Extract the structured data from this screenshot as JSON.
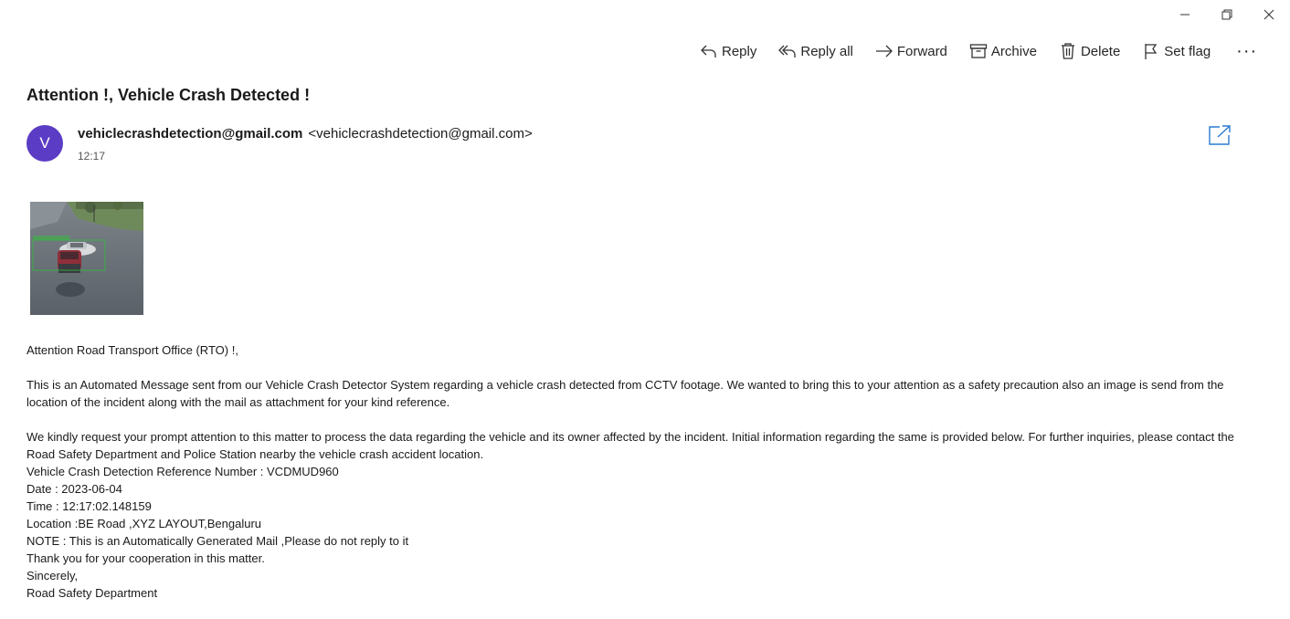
{
  "window": {
    "controls": [
      "minimize-icon",
      "restore-icon",
      "close-icon"
    ]
  },
  "toolbar": {
    "reply": "Reply",
    "reply_all": "Reply all",
    "forward": "Forward",
    "archive": "Archive",
    "delete": "Delete",
    "set_flag": "Set flag",
    "more": "···"
  },
  "message": {
    "subject": "Attention !, Vehicle Crash Detected !",
    "avatar_letter": "V",
    "sender_name": "vehiclecrashdetection@gmail.com",
    "sender_address": "<vehiclecrashdetection@gmail.com>",
    "time": "12:17",
    "greeting": "Attention Road Transport Office (RTO) !,",
    "para1": "This is an Automated Message sent from our Vehicle Crash Detector System regarding a vehicle crash detected from CCTV footage. We wanted to bring this to your attention as a safety precaution also an image is send from the location of the incident along with the mail as attachment for your kind reference.",
    "para2": "We kindly request your prompt attention to this matter to process the data regarding the vehicle and its owner affected by the incident. Initial information regarding the same is provided below. For further inquiries, please contact the Road Safety Department and Police Station nearby the vehicle crash accident location.",
    "reference": "Vehicle Crash Detection Reference Number : VCDMUD960",
    "date": "Date : 2023-06-04",
    "timestamp": "Time : 12:17:02.148159",
    "location": "Location :BE Road ,XYZ LAYOUT,Bengaluru",
    "note": "NOTE : This is an Automatically Generated Mail ,Please do not reply to it",
    "thanks": "Thank you for your cooperation in this matter.",
    "closing": "Sincerely,",
    "signature": "Road Safety Department"
  },
  "colors": {
    "avatar": "#5b3cc4",
    "popout_icon": "#2a7ad0"
  }
}
